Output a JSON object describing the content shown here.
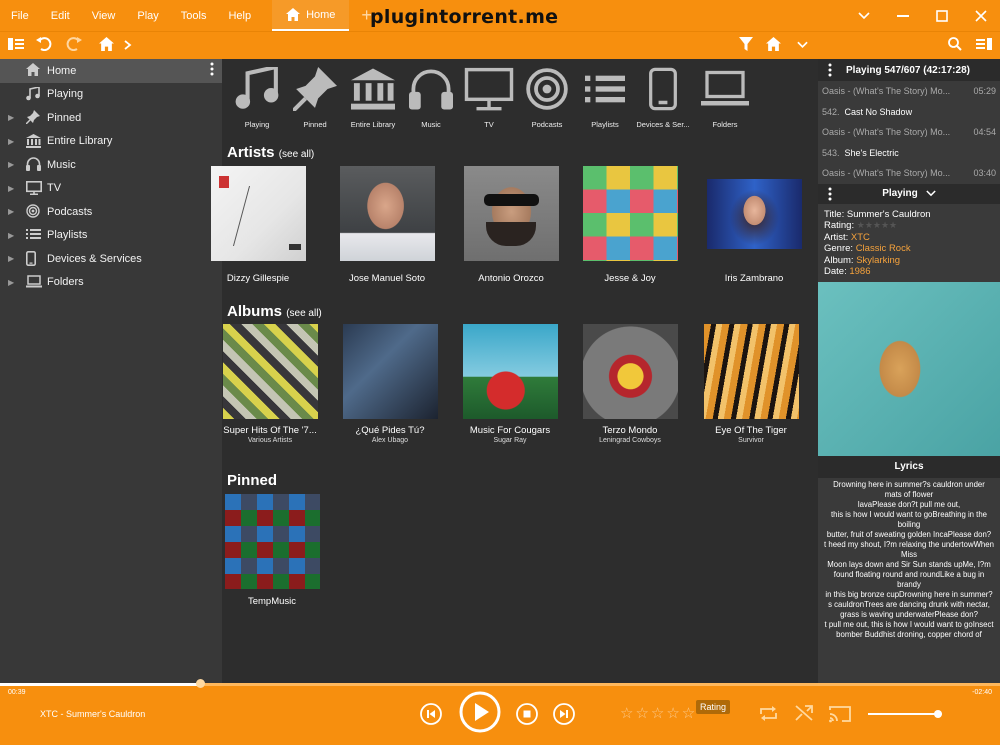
{
  "menu": [
    "File",
    "Edit",
    "View",
    "Play",
    "Tools",
    "Help"
  ],
  "tab": {
    "label": "Home",
    "add": "+"
  },
  "watermark": "plugintorrent.me",
  "sidebar": {
    "items": [
      {
        "label": "Home",
        "icon": "home-icon"
      },
      {
        "label": "Playing",
        "icon": "music-note-icon"
      },
      {
        "label": "Pinned",
        "icon": "pin-icon"
      },
      {
        "label": "Entire Library",
        "icon": "library-icon"
      },
      {
        "label": "Music",
        "icon": "headphones-icon"
      },
      {
        "label": "TV",
        "icon": "monitor-icon"
      },
      {
        "label": "Podcasts",
        "icon": "podcast-icon"
      },
      {
        "label": "Playlists",
        "icon": "playlist-icon"
      },
      {
        "label": "Devices & Services",
        "icon": "phone-icon"
      },
      {
        "label": "Folders",
        "icon": "laptop-icon"
      }
    ]
  },
  "categories": [
    "Playing",
    "Pinned",
    "Entire Library",
    "Music",
    "TV",
    "Podcasts",
    "Playlists",
    "Devices & Ser...",
    "Folders"
  ],
  "artists": {
    "title": "Artists",
    "see_all": "(see all)",
    "items": [
      "Dizzy Gillespie",
      "Jose Manuel Soto",
      "Antonio Orozco",
      "Jesse & Joy",
      "Iris Zambrano"
    ]
  },
  "albums": {
    "title": "Albums",
    "see_all": "(see all)",
    "items": [
      {
        "title": "Super Hits Of The '7...",
        "artist": "Various Artists"
      },
      {
        "title": "¿Qué Pides Tú?",
        "artist": "Alex Ubago"
      },
      {
        "title": "Music For Cougars",
        "artist": "Sugar Ray"
      },
      {
        "title": "Terzo Mondo",
        "artist": "Leningrad Cowboys"
      },
      {
        "title": "Eye Of The Tiger",
        "artist": "Survivor"
      }
    ]
  },
  "pinned": {
    "title": "Pinned",
    "items": [
      "TempMusic"
    ]
  },
  "now_playing_list": {
    "header": "Playing 547/607 (42:17:28)",
    "rows": [
      {
        "album": "Oasis - (What's The Story) Mo...",
        "time": "05:29"
      },
      {
        "num": "542.",
        "title": "Cast No Shadow"
      },
      {
        "album": "Oasis - (What's The Story) Mo...",
        "time": "04:54"
      },
      {
        "num": "543.",
        "title": "She's Electric"
      },
      {
        "album": "Oasis - (What's The Story) Mo...",
        "time": "03:40"
      }
    ]
  },
  "playing_panel": {
    "header": "Playing",
    "title_label": "Title:",
    "title": "Summer's Cauldron",
    "rating_label": "Rating:",
    "artist_label": "Artist:",
    "artist": "XTC",
    "genre_label": "Genre:",
    "genre": "Classic Rock",
    "album_label": "Album:",
    "album": "Skylarking",
    "date_label": "Date:",
    "date": "1986"
  },
  "lyrics": {
    "header": "Lyrics",
    "lines": [
      "Drowning here in summer?s cauldron under mats of flower",
      "lavaPlease don?t pull me out,",
      "this is how I would want to goBreathing in the boiling",
      "butter, fruit of sweating golden IncaPlease don?",
      "t heed my shout, I?m relaxing the undertowWhen Miss",
      "Moon lays down and Sir Sun stands upMe, I?m found floating round and roundLike a bug in brandy",
      "in this big bronze cupDrowning here in summer?",
      "s cauldronTrees are dancing drunk with nectar,",
      "grass is waving underwaterPlease don?",
      "t pull me out, this is how I would want to goInsect",
      "bomber Buddhist droning, copper chord of"
    ]
  },
  "player": {
    "elapsed": "00:39",
    "remaining": "-02:40",
    "now_playing": "XTC - Summer's Cauldron",
    "rating_tooltip": "Rating",
    "progress": 0.2,
    "volume": 0.95
  },
  "colors": {
    "accent": "#f78f0e",
    "link": "#f5a23c"
  }
}
